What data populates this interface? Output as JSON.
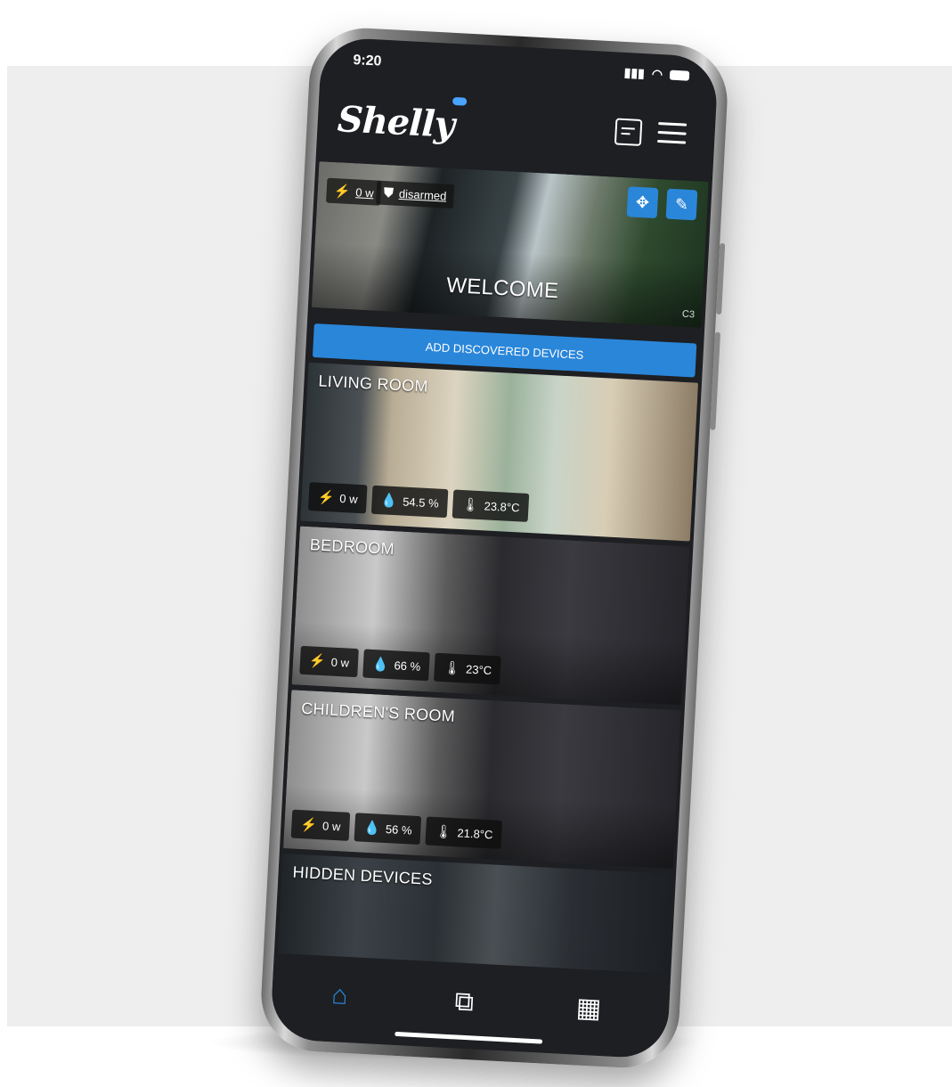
{
  "status": {
    "time": "9:20"
  },
  "app": {
    "logo": "Shelly"
  },
  "welcome": {
    "title": "WELCOME",
    "power": "0 w",
    "security": "disarmed",
    "cam": "C3"
  },
  "actions": {
    "add_discovered": "ADD DISCOVERED DEVICES"
  },
  "rooms": [
    {
      "title": "LIVING ROOM",
      "power": "0 w",
      "humidity": "54.5 %",
      "temperature": "23.8°C"
    },
    {
      "title": "BEDROOM",
      "power": "0 w",
      "humidity": "66 %",
      "temperature": "23°C"
    },
    {
      "title": "CHILDREN'S ROOM",
      "power": "0 w",
      "humidity": "56 %",
      "temperature": "21.8°C"
    }
  ],
  "hidden": {
    "title": "HIDDEN DEVICES"
  },
  "colors": {
    "accent": "#2a86d9",
    "background": "#1d1f22"
  }
}
